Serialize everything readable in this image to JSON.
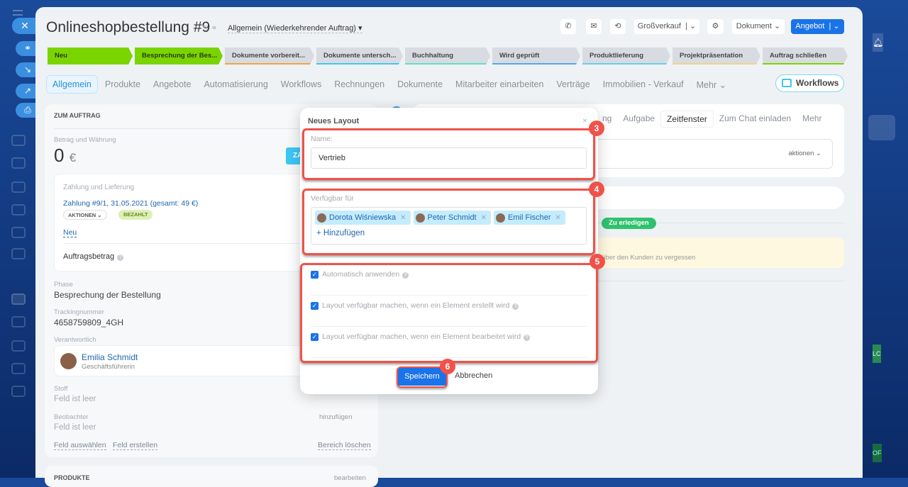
{
  "left_sidebar": {
    "floating_buttons": [
      "close-icon",
      "link-icon",
      "download-icon",
      "open-icon",
      "print-icon"
    ]
  },
  "header": {
    "title": "Onlineshopbestellung #9",
    "category": "Allgemein (Wiederkehrender Auftrag)",
    "buttons": {
      "sales": "Großverkauf",
      "document": "Dokument",
      "offer": "Angebot"
    }
  },
  "stages": [
    {
      "label": "Neu",
      "done": true,
      "color": "#7ad400"
    },
    {
      "label": "Besprechung der Bes...",
      "done": true,
      "color": "#7ad400"
    },
    {
      "label": "Dokumente vorbereit...",
      "done": false,
      "color": "#f5a340"
    },
    {
      "label": "Dokumente untersch...",
      "done": false,
      "color": "#3bc8f5"
    },
    {
      "label": "Buchhaltung",
      "done": false,
      "color": "#5fe0c8"
    },
    {
      "label": "Wird geprüft",
      "done": false,
      "color": "#55a8f0"
    },
    {
      "label": "Produktlieferung",
      "done": false,
      "color": "#62d3e8"
    },
    {
      "label": "Projektpräsentation",
      "done": false,
      "color": "#f3d38a"
    },
    {
      "label": "Auftrag schließen",
      "done": false,
      "color": "#7ad400"
    }
  ],
  "tabs": [
    "Allgemein",
    "Produkte",
    "Angebote",
    "Automatisierung",
    "Workflows",
    "Rechnungen",
    "Dokumente",
    "Mitarbeiter einarbeiten",
    "Verträge",
    "Immobilien - Verkauf",
    "Mehr"
  ],
  "workflows_button": "Workflows",
  "order_card": {
    "heading": "ZUM AUFTRAG",
    "amount_label": "Betrag und Währung",
    "amount": "0",
    "currency": "€",
    "pay_button": "ZA",
    "payment": {
      "label": "Zahlung und Lieferung",
      "link": "Zahlung #9/1, 31.05.2021 (gesamt: 49 €)",
      "actions": "AKTIONEN",
      "status": "BEZAHLT",
      "new": "Neu"
    },
    "order_total_label": "Auftragsbetrag",
    "phase_label": "Phase",
    "phase": "Besprechung der Bestellung",
    "tracking_label": "Trackingnummer",
    "tracking": "4658759809_4GH",
    "responsible_label": "Verantwortlich",
    "responsible_name": "Emilia Schmidt",
    "responsible_role": "Geschäftsführerin",
    "stoff_label": "Stoff",
    "stoff": "Feld ist leer",
    "observers_label": "Beobachter",
    "observers_add": "hinzufügen",
    "observers": "Feld ist leer",
    "select_field": "Feld auswählen",
    "create_field": "Feld erstellen",
    "delete_section": "Bereich löschen"
  },
  "products_card": {
    "heading": "PRODUKTE",
    "edit": "bearbeiten"
  },
  "timeline": {
    "tabs": [
      "ng",
      "Aufgabe",
      "Zeitfenster",
      "Zum Chat einladen",
      "Mehr"
    ],
    "actions": "aktionen",
    "todo_badge": "Zu erledigen",
    "note": "t über den Kunden zu vergessen"
  },
  "popup": {
    "title": "Neues Layout",
    "name_label": "Name:",
    "name_value": "Vertrieb",
    "available_label": "Verfügbar für",
    "users": [
      "Dorota Wiśniewska",
      "Peter Schmidt",
      "Emil Fischer"
    ],
    "add": "+ Hinzufügen",
    "options": [
      {
        "label": "Automatisch anwenden",
        "checked": true
      },
      {
        "label": "Layout verfügbar machen, wenn ein Element erstellt wird",
        "checked": true
      },
      {
        "label": "Layout verfügbar machen, wenn ein Element bearbeitet wird",
        "checked": true
      }
    ],
    "save": "Speichern",
    "cancel": "Abbrechen"
  },
  "callouts": [
    "3",
    "4",
    "5",
    "6"
  ],
  "right_sidebar": {
    "initials": [
      "LC",
      "OF"
    ]
  }
}
